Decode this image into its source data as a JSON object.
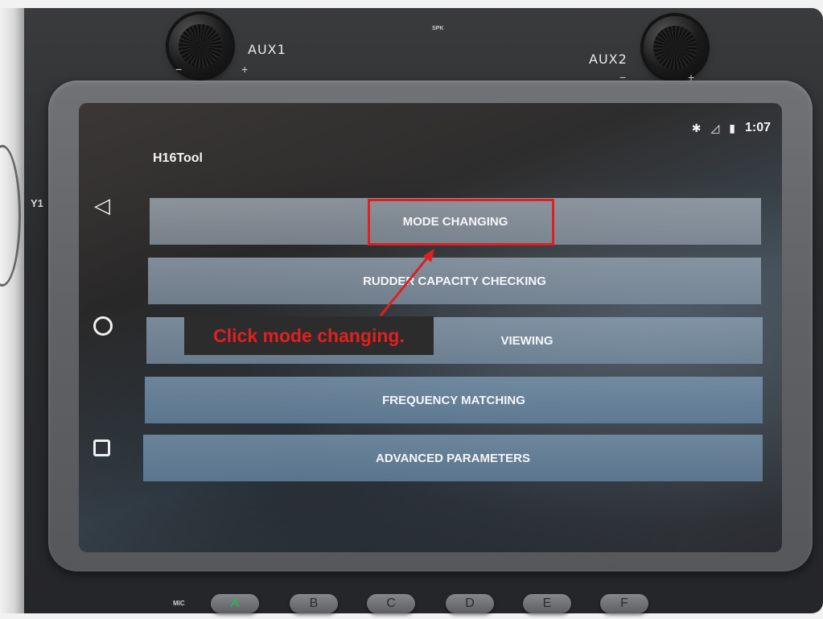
{
  "device": {
    "knob_labels": {
      "aux1": "AUX1",
      "aux2": "AUX2"
    },
    "speaker_label": "SPK",
    "mic_label": "MIC",
    "side_label": "Y1",
    "hardware_buttons": [
      "A",
      "B",
      "C",
      "D",
      "E",
      "F"
    ]
  },
  "status_bar": {
    "time": "1:07",
    "bluetooth_icon": "bluetooth-icon",
    "signal_icon": "signal-icon",
    "battery_icon": "battery-icon"
  },
  "app": {
    "title": "H16Tool",
    "menu": [
      "MODE CHANGING",
      "RUDDER CAPACITY CHECKING",
      "VIEWING",
      "FREQUENCY MATCHING",
      "ADVANCED PARAMETERS"
    ]
  },
  "annotation": {
    "callout_text": "Click mode changing.",
    "color": "#e02020"
  },
  "nav_bar": {
    "back_icon": "back-triangle-icon",
    "home_icon": "home-circle-icon",
    "recent_icon": "recent-square-icon"
  }
}
